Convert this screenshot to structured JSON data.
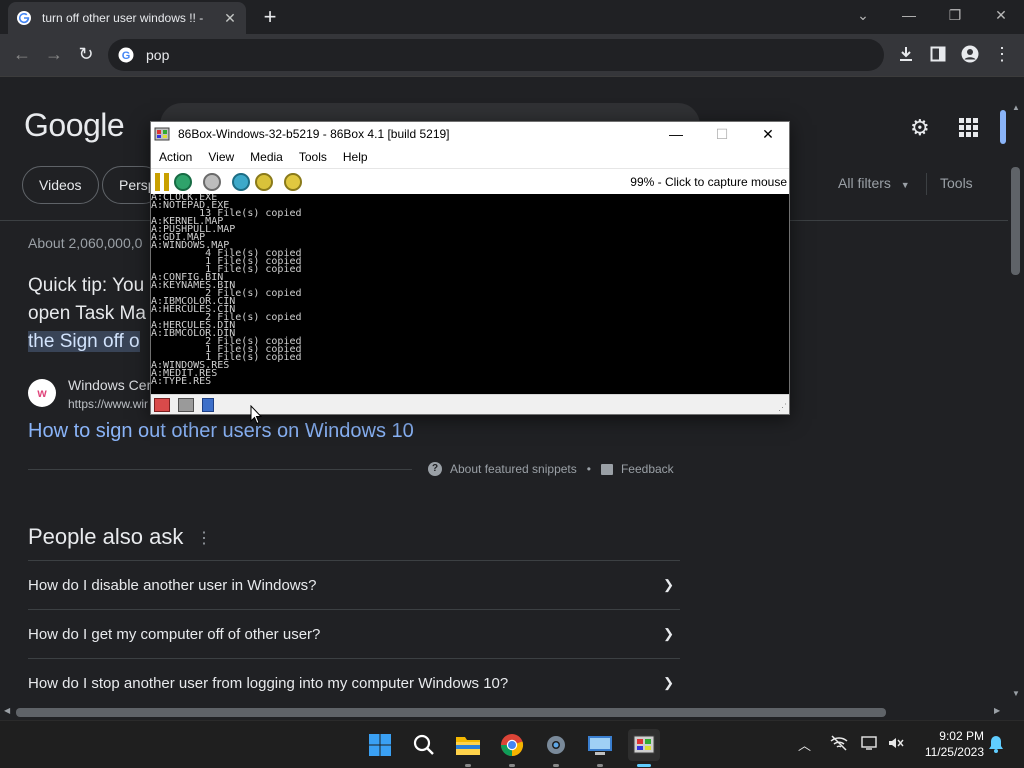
{
  "browser": {
    "tab_title": "turn off other user windows !! -",
    "tab_close": "✕",
    "new_tab": "+",
    "omnibox_text": "pop"
  },
  "google": {
    "logo": "Google",
    "chips": [
      "Videos",
      "Persp"
    ],
    "all_filters": "All filters",
    "tools": "Tools",
    "result_stats": "About 2,060,000,0",
    "snippet_lines": [
      "Quick tip: You",
      "open Task Ma"
    ],
    "snippet_highlight": "the Sign off o",
    "source_name": "Windows Cer",
    "source_url": "https://www.wir",
    "snippet_link": "How to sign out other users on Windows 10",
    "about_snippets": "About featured snippets",
    "feedback": "Feedback",
    "paa_title": "People also ask",
    "paa_questions": [
      "How do I disable another user in Windows?",
      "How do I get my computer off of other user?",
      "How do I stop another user from logging into my computer Windows 10?"
    ]
  },
  "emulator": {
    "title": "86Box-Windows-32-b5219 - 86Box 4.1 [build 5219]",
    "menu": [
      "Action",
      "View",
      "Media",
      "Tools",
      "Help"
    ],
    "status": "99% - Click to capture mouse",
    "dos_output": "A:CLOCK.EXE\nA:NOTEPAD.EXE\n        13 File(s) copied\nA:KERNEL.MAP\nA:PUSHPULL.MAP\nA:GDI.MAP\nA:WINDOWS.MAP\n         4 File(s) copied\n         1 File(s) copied\n         1 File(s) copied\nA:CONFIG.BIN\nA:KEYNAMES.BIN\n         2 File(s) copied\nA:IBMCOLOR.CIN\nA:HERCULES.CIN\n         2 File(s) copied\nA:HERCULES.DIN\nA:IBMCOLOR.DIN\n         2 File(s) copied\n         1 File(s) copied\n         1 File(s) copied\nA:WINDOWS.RES\nA:MEDIT.RES\nA:TYPE.RES"
  },
  "taskbar": {
    "time": "9:02 PM",
    "date": "11/25/2023"
  },
  "colors": {
    "page_bg": "#202124",
    "link_blue": "#8ab4f8",
    "highlight_bg": "#394457",
    "taskbar_bg": "#1f1f1f",
    "accent_blue": "#60cdff"
  },
  "icons": [
    "google-favicon",
    "back-arrow-icon",
    "forward-arrow-icon",
    "reload-icon",
    "download-icon",
    "sidepanel-icon",
    "profile-icon",
    "kebab-menu-icon",
    "gear-icon",
    "apps-grid-icon",
    "chevron-down-icon",
    "pause-icon",
    "reset-icon",
    "power-icon",
    "settings-icon",
    "start-icon",
    "search-icon",
    "file-explorer-icon",
    "chrome-icon",
    "notification-bell-icon"
  ]
}
